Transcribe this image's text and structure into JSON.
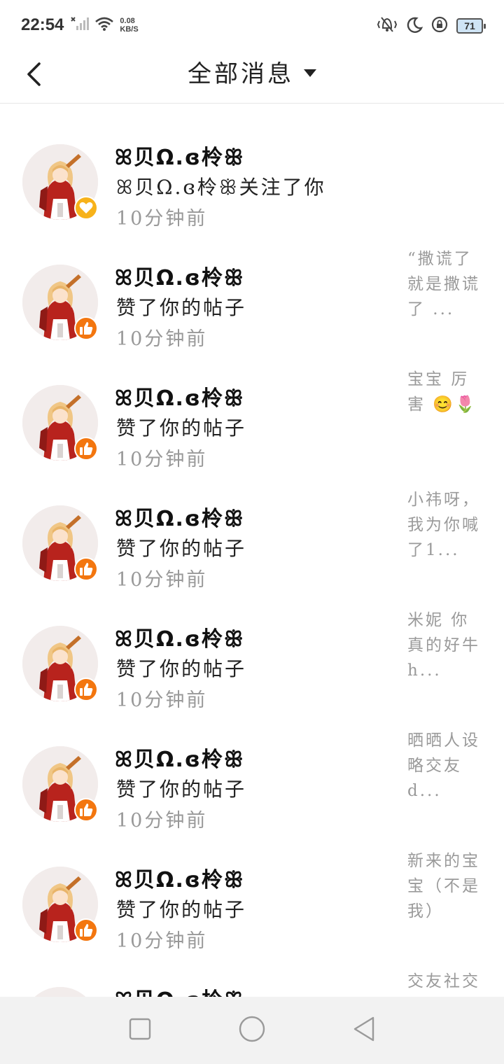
{
  "status_bar": {
    "time": "22:54",
    "net_speed_value": "0.08",
    "net_speed_unit": "KB/S",
    "battery": "71"
  },
  "header": {
    "title": "全部消息"
  },
  "messages": [
    {
      "name": "ꕤ贝Ω.ɞ柃ꕥ",
      "action": "ꕤ贝Ω.ɞ柃ꕥ关注了你",
      "time": "10分钟前",
      "badge": "heart",
      "preview": ""
    },
    {
      "name": "ꕤ贝Ω.ɞ柃ꕥ",
      "action": "赞了你的帖子",
      "time": "10分钟前",
      "badge": "like",
      "preview": "“撒谎了就是撒谎了 ..."
    },
    {
      "name": "ꕤ贝Ω.ɞ柃ꕥ",
      "action": "赞了你的帖子",
      "time": "10分钟前",
      "badge": "like",
      "preview": "宝宝 厉害 😊🌷"
    },
    {
      "name": "ꕤ贝Ω.ɞ柃ꕥ",
      "action": "赞了你的帖子",
      "time": "10分钟前",
      "badge": "like",
      "preview": "小祎呀，我为你喊了1..."
    },
    {
      "name": "ꕤ贝Ω.ɞ柃ꕥ",
      "action": "赞了你的帖子",
      "time": "10分钟前",
      "badge": "like",
      "preview": "米妮 你真的好牛h..."
    },
    {
      "name": "ꕤ贝Ω.ɞ柃ꕥ",
      "action": "赞了你的帖子",
      "time": "10分钟前",
      "badge": "like",
      "preview": "晒晒人设略交友d..."
    },
    {
      "name": "ꕤ贝Ω.ɞ柃ꕥ",
      "action": "赞了你的帖子",
      "time": "10分钟前",
      "badge": "like",
      "preview": "新来的宝宝（不是我）"
    },
    {
      "name": "ꕤ贝Ω.ɞ柃ꕥ",
      "action": "",
      "time": "",
      "badge": "",
      "preview": "交友社交"
    }
  ],
  "icons": {
    "back": "chevron-left-icon",
    "dropdown": "caret-down-icon",
    "heart_badge": "heart-icon",
    "like_badge": "thumbs-up-icon",
    "nav_recents": "square-icon",
    "nav_home": "circle-icon",
    "nav_back": "triangle-back-icon"
  },
  "colors": {
    "heart_badge": "#f7b21a",
    "like_badge": "#f3760f",
    "muted_text": "#999999"
  }
}
